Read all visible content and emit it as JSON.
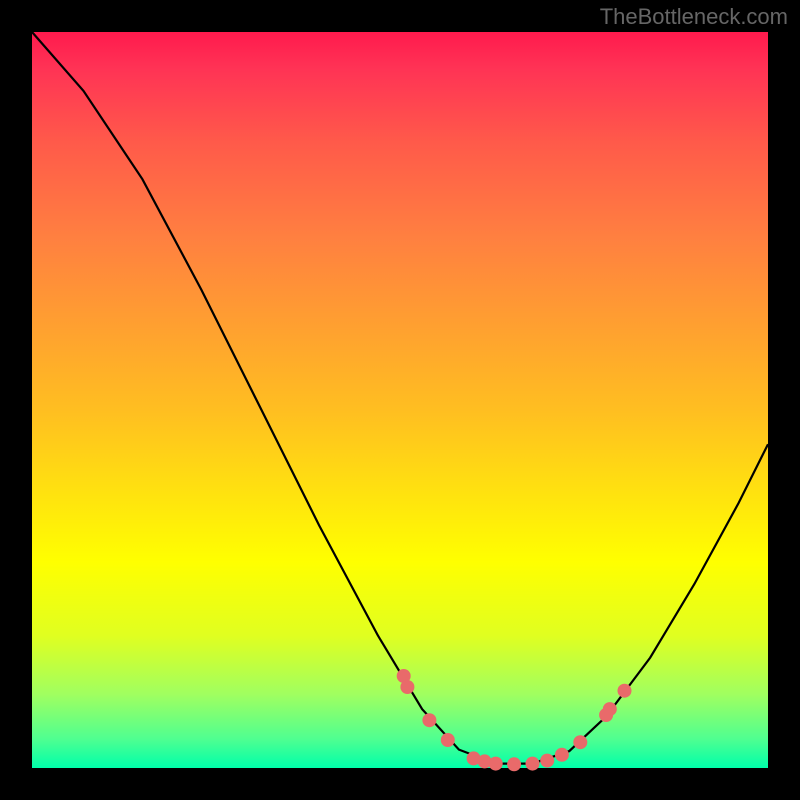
{
  "watermark": "TheBottleneck.com",
  "chart_data": {
    "type": "line",
    "title": "",
    "xlabel": "",
    "ylabel": "",
    "xlim": [
      0,
      100
    ],
    "ylim": [
      0,
      100
    ],
    "curve": [
      {
        "x": 0.0,
        "y": 100.0
      },
      {
        "x": 7.0,
        "y": 92.0
      },
      {
        "x": 15.0,
        "y": 80.0
      },
      {
        "x": 23.0,
        "y": 65.0
      },
      {
        "x": 31.0,
        "y": 49.0
      },
      {
        "x": 39.0,
        "y": 33.0
      },
      {
        "x": 47.0,
        "y": 18.0
      },
      {
        "x": 53.0,
        "y": 8.0
      },
      {
        "x": 58.0,
        "y": 2.5
      },
      {
        "x": 63.0,
        "y": 0.6
      },
      {
        "x": 68.0,
        "y": 0.6
      },
      {
        "x": 73.0,
        "y": 2.3
      },
      {
        "x": 78.0,
        "y": 7.0
      },
      {
        "x": 84.0,
        "y": 15.0
      },
      {
        "x": 90.0,
        "y": 25.0
      },
      {
        "x": 96.0,
        "y": 36.0
      },
      {
        "x": 100.0,
        "y": 44.0
      }
    ],
    "markers": [
      {
        "x": 50.5,
        "y": 12.5
      },
      {
        "x": 51.0,
        "y": 11.0
      },
      {
        "x": 54.0,
        "y": 6.5
      },
      {
        "x": 56.5,
        "y": 3.8
      },
      {
        "x": 60.0,
        "y": 1.3
      },
      {
        "x": 61.5,
        "y": 0.9
      },
      {
        "x": 63.0,
        "y": 0.6
      },
      {
        "x": 65.5,
        "y": 0.5
      },
      {
        "x": 68.0,
        "y": 0.6
      },
      {
        "x": 70.0,
        "y": 1.0
      },
      {
        "x": 72.0,
        "y": 1.8
      },
      {
        "x": 74.5,
        "y": 3.5
      },
      {
        "x": 78.0,
        "y": 7.2
      },
      {
        "x": 78.5,
        "y": 8.0
      },
      {
        "x": 80.5,
        "y": 10.5
      }
    ]
  }
}
